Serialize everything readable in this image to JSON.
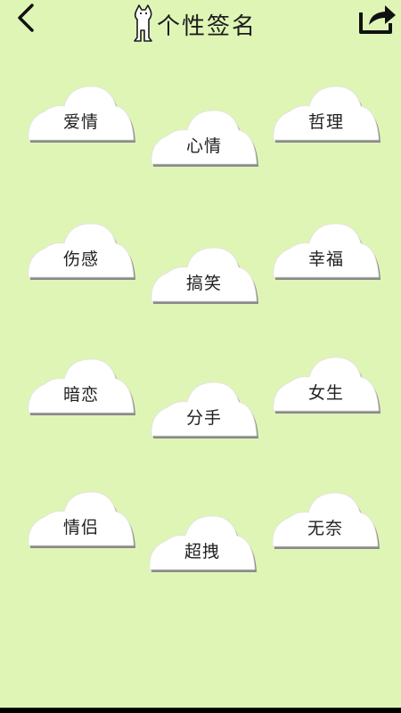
{
  "header": {
    "title": "个性签名",
    "back_icon": "chevron-left-icon",
    "share_icon": "share-icon"
  },
  "colors": {
    "background": "#dff5b6",
    "cloud_fill": "#ffffff",
    "cloud_shadow": "#8a8a8a",
    "text": "#1c1c1c"
  },
  "categories": [
    {
      "label": "爱情"
    },
    {
      "label": "心情"
    },
    {
      "label": "哲理"
    },
    {
      "label": "伤感"
    },
    {
      "label": "搞笑"
    },
    {
      "label": "幸福"
    },
    {
      "label": "暗恋"
    },
    {
      "label": "分手"
    },
    {
      "label": "女生"
    },
    {
      "label": "情侣"
    },
    {
      "label": "超拽"
    },
    {
      "label": "无奈"
    }
  ]
}
